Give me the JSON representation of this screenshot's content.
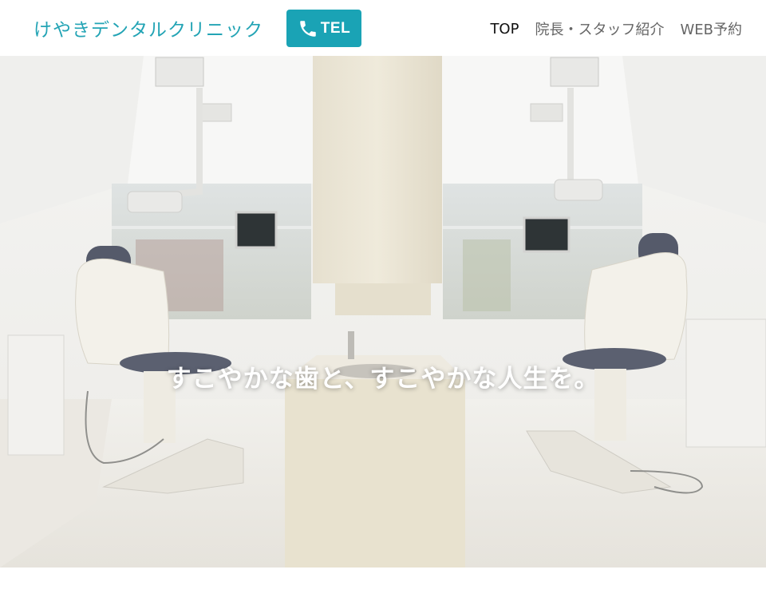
{
  "header": {
    "brand": "けやきデンタルクリニック",
    "tel_label": "TEL",
    "nav": [
      {
        "label": "TOP",
        "active": true
      },
      {
        "label": "院長・スタッフ紹介",
        "active": false
      },
      {
        "label": "WEB予約",
        "active": false
      }
    ]
  },
  "hero": {
    "tagline": "すこやかな歯と、すこやかな人生を。"
  },
  "colors": {
    "accent": "#1aa3b5",
    "brand_text": "#23a4b5",
    "nav_active": "#111111",
    "nav_inactive": "#666666"
  },
  "icons": {
    "tel": "phone-icon"
  }
}
